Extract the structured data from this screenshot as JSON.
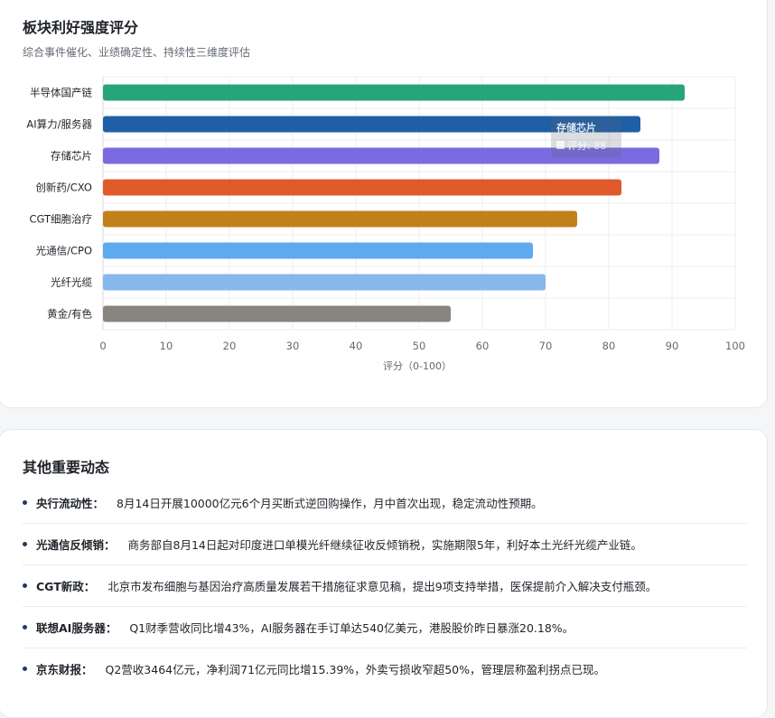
{
  "chart_card": {
    "title": "板块利好强度评分",
    "subtitle": "综合事件催化、业绩确定性、持续性三维度评估"
  },
  "chart_data": {
    "type": "bar",
    "orientation": "horizontal",
    "categories": [
      "半导体国产链",
      "AI算力/服务器",
      "存储芯片",
      "创新药/CXO",
      "CGT细胞治疗",
      "光通信/CPO",
      "光纤光缆",
      "黄金/有色"
    ],
    "values": [
      92,
      85,
      88,
      82,
      75,
      68,
      70,
      55
    ],
    "colors": [
      "#27a57a",
      "#1f5fa6",
      "#7b6be0",
      "#e05a2c",
      "#c2801c",
      "#5eaaf0",
      "#86b8ec",
      "#888580"
    ],
    "xlim": [
      0,
      100
    ],
    "xticks": [
      0,
      10,
      20,
      30,
      40,
      50,
      60,
      70,
      80,
      90,
      100
    ],
    "xlabel": "评分（0-100）",
    "ylabel": "",
    "grid": true,
    "tooltip": {
      "category": "存储芯片",
      "text": "评分: 88"
    }
  },
  "news_card": {
    "title": "其他重要动态",
    "items": [
      {
        "label": "央行流动性：",
        "text": "8月14日开展10000亿元6个月买断式逆回购操作，月中首次出现，稳定流动性预期。"
      },
      {
        "label": "光通信反倾销：",
        "text": "商务部自8月14日起对印度进口单模光纤继续征收反倾销税，实施期限5年，利好本土光纤光缆产业链。"
      },
      {
        "label": "CGT新政：",
        "text": "北京市发布细胞与基因治疗高质量发展若干措施征求意见稿，提出9项支持举措，医保提前介入解决支付瓶颈。"
      },
      {
        "label": "联想AI服务器：",
        "text": "Q1财季营收同比增43%，AI服务器在手订单达540亿美元，港股股价昨日暴涨20.18%。"
      },
      {
        "label": "京东财报：",
        "text": "Q2营收3464亿元，净利润71亿元同比增15.39%，外卖亏损收窄超50%，管理层称盈利拐点已现。"
      }
    ]
  }
}
